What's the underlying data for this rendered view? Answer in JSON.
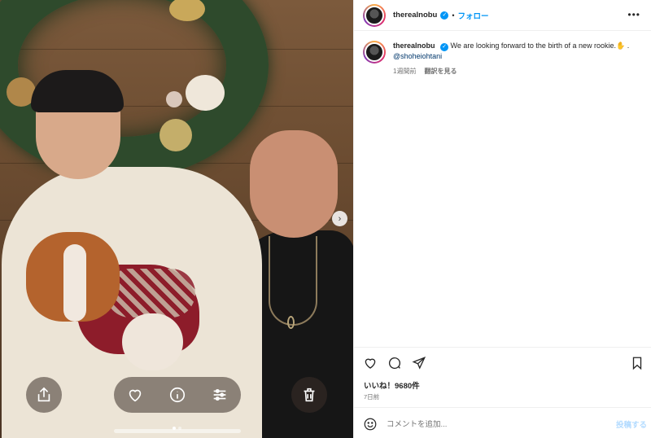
{
  "header": {
    "username": "therealnobu",
    "separator": "•",
    "follow_label": "フォロー",
    "more_label": "•••"
  },
  "caption": {
    "username": "therealnobu",
    "text": "We are looking forward to the birth of a new rookie.",
    "emoji": "✋",
    "separator": ".",
    "mention": "@shoheiohtani",
    "time": "1週間前",
    "translation_label": "翻訳を見る"
  },
  "photo": {
    "next_label": "›",
    "carousel_position": 1,
    "carousel_total": 2
  },
  "stats": {
    "likes": "いいね！9680件",
    "time": "7日前"
  },
  "comment": {
    "placeholder": "コメントを追加...",
    "post_label": "投稿する"
  },
  "icons": {
    "share": "share-icon",
    "heart": "heart-icon",
    "info": "info-icon",
    "adjust": "sliders-icon",
    "trash": "trash-icon",
    "like": "heart-icon",
    "comment": "comment-icon",
    "send": "send-icon",
    "save": "bookmark-icon",
    "emoji": "emoji-icon"
  },
  "colors": {
    "accent": "#0095f6",
    "text": "#262626",
    "muted": "#737373",
    "mention": "#00376b"
  }
}
